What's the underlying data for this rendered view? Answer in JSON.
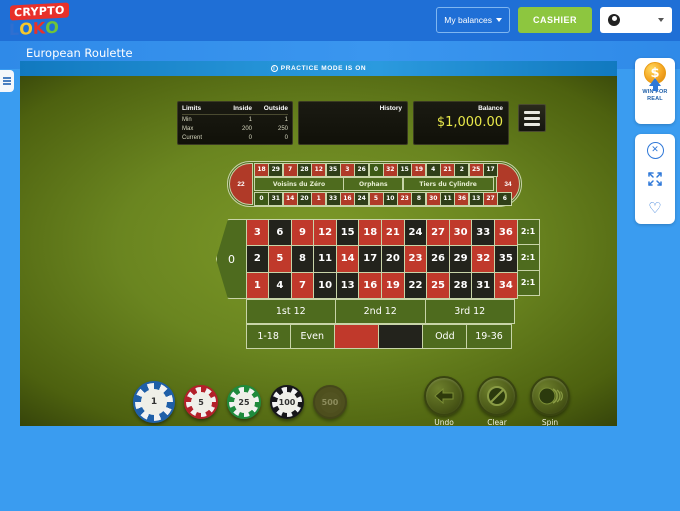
{
  "header": {
    "logo_top": "CRYPTO",
    "logo_bottom": "LOKO",
    "balances_label": "My balances",
    "cashier_label": "CASHIER"
  },
  "title_strip": {
    "page_title": "European Roulette"
  },
  "game": {
    "practice_notice": "PRACTICE MODE IS ON",
    "limits": {
      "title": "Limits",
      "col_inside": "Inside",
      "col_outside": "Outside",
      "rows": [
        {
          "label": "Min",
          "inside": "1",
          "outside": "1"
        },
        {
          "label": "Max",
          "inside": "200",
          "outside": "250"
        },
        {
          "label": "Current",
          "inside": "0",
          "outside": "0"
        }
      ]
    },
    "history_label": "History",
    "balance_label": "Balance",
    "balance_value": "$1,000.00"
  },
  "racetrack": {
    "cap_left": "22",
    "cap_right": "34",
    "top_row": [
      {
        "n": "18",
        "c": "red"
      },
      {
        "n": "29",
        "c": "blk"
      },
      {
        "n": "7",
        "c": "red"
      },
      {
        "n": "28",
        "c": "blk"
      },
      {
        "n": "12",
        "c": "red"
      },
      {
        "n": "35",
        "c": "blk"
      },
      {
        "n": "3",
        "c": "red"
      },
      {
        "n": "26",
        "c": "blk"
      },
      {
        "n": "0",
        "c": "grn"
      },
      {
        "n": "32",
        "c": "red"
      },
      {
        "n": "15",
        "c": "blk"
      },
      {
        "n": "19",
        "c": "red"
      },
      {
        "n": "4",
        "c": "blk"
      },
      {
        "n": "21",
        "c": "red"
      },
      {
        "n": "2",
        "c": "blk"
      },
      {
        "n": "25",
        "c": "red"
      },
      {
        "n": "17",
        "c": "blk"
      }
    ],
    "bottom_row": [
      {
        "n": "0",
        "c": "grn"
      },
      {
        "n": "31",
        "c": "blk"
      },
      {
        "n": "14",
        "c": "red"
      },
      {
        "n": "20",
        "c": "blk"
      },
      {
        "n": "1",
        "c": "red"
      },
      {
        "n": "33",
        "c": "blk"
      },
      {
        "n": "16",
        "c": "red"
      },
      {
        "n": "24",
        "c": "blk"
      },
      {
        "n": "5",
        "c": "red"
      },
      {
        "n": "10",
        "c": "blk"
      },
      {
        "n": "23",
        "c": "red"
      },
      {
        "n": "8",
        "c": "blk"
      },
      {
        "n": "30",
        "c": "red"
      },
      {
        "n": "11",
        "c": "blk"
      },
      {
        "n": "36",
        "c": "red"
      },
      {
        "n": "13",
        "c": "blk"
      },
      {
        "n": "27",
        "c": "red"
      },
      {
        "n": "6",
        "c": "blk"
      }
    ],
    "zones": [
      {
        "label": "Voisins du Zéro",
        "cls": "zn-a"
      },
      {
        "label": "Orphans",
        "cls": "zn-b"
      },
      {
        "label": "Tiers du Cylindre",
        "cls": "zn-c"
      }
    ]
  },
  "bet_grid": {
    "zero": "0",
    "numbers": [
      {
        "n": "3",
        "c": "red"
      },
      {
        "n": "6",
        "c": "blk"
      },
      {
        "n": "9",
        "c": "red"
      },
      {
        "n": "12",
        "c": "red"
      },
      {
        "n": "15",
        "c": "blk"
      },
      {
        "n": "18",
        "c": "red"
      },
      {
        "n": "21",
        "c": "red"
      },
      {
        "n": "24",
        "c": "blk"
      },
      {
        "n": "27",
        "c": "red"
      },
      {
        "n": "30",
        "c": "red"
      },
      {
        "n": "33",
        "c": "blk"
      },
      {
        "n": "36",
        "c": "red"
      },
      {
        "n": "2",
        "c": "blk"
      },
      {
        "n": "5",
        "c": "red"
      },
      {
        "n": "8",
        "c": "blk"
      },
      {
        "n": "11",
        "c": "blk"
      },
      {
        "n": "14",
        "c": "red"
      },
      {
        "n": "17",
        "c": "blk"
      },
      {
        "n": "20",
        "c": "blk"
      },
      {
        "n": "23",
        "c": "red"
      },
      {
        "n": "26",
        "c": "blk"
      },
      {
        "n": "29",
        "c": "blk"
      },
      {
        "n": "32",
        "c": "red"
      },
      {
        "n": "35",
        "c": "blk"
      },
      {
        "n": "1",
        "c": "red"
      },
      {
        "n": "4",
        "c": "blk"
      },
      {
        "n": "7",
        "c": "red"
      },
      {
        "n": "10",
        "c": "blk"
      },
      {
        "n": "13",
        "c": "blk"
      },
      {
        "n": "16",
        "c": "red"
      },
      {
        "n": "19",
        "c": "red"
      },
      {
        "n": "22",
        "c": "blk"
      },
      {
        "n": "25",
        "c": "red"
      },
      {
        "n": "28",
        "c": "blk"
      },
      {
        "n": "31",
        "c": "blk"
      },
      {
        "n": "34",
        "c": "red"
      }
    ],
    "column_bets": [
      "2:1",
      "2:1",
      "2:1"
    ],
    "dozens": [
      "1st 12",
      "2nd 12",
      "3rd 12"
    ],
    "even_money": [
      {
        "label": "1-18",
        "cls": ""
      },
      {
        "label": "Even",
        "cls": ""
      },
      {
        "label": "",
        "cls": "eb-red"
      },
      {
        "label": "",
        "cls": "eb-blk"
      },
      {
        "label": "Odd",
        "cls": ""
      },
      {
        "label": "19-36",
        "cls": ""
      }
    ]
  },
  "chips": [
    {
      "value": "1",
      "cls": "c1"
    },
    {
      "value": "5",
      "cls": "c5"
    },
    {
      "value": "25",
      "cls": "c25"
    },
    {
      "value": "100",
      "cls": "c100"
    },
    {
      "value": "500",
      "cls": "c500"
    }
  ],
  "actions": [
    {
      "label": "Undo",
      "icon": "undo-arrow-icon"
    },
    {
      "label": "Clear",
      "icon": "no-entry-icon"
    },
    {
      "label": "Spin",
      "icon": "spin-wheel-icon"
    }
  ],
  "right_panel": {
    "win_for_real": "WIN FOR\nREAL",
    "win_for_real_line1": "WIN FOR",
    "win_for_real_line2": "REAL",
    "coin_symbol": "$",
    "close_symbol": "✕",
    "expand_symbol": "⤡",
    "heart_symbol": "♡"
  },
  "colors": {
    "brand_blue": "#1f6fd6",
    "cashier_green": "#8dc63f",
    "felt_green": "#6a8520",
    "roulette_red": "#c0392b",
    "roulette_black": "#23231c",
    "balance_yellow": "#e8e84a"
  }
}
